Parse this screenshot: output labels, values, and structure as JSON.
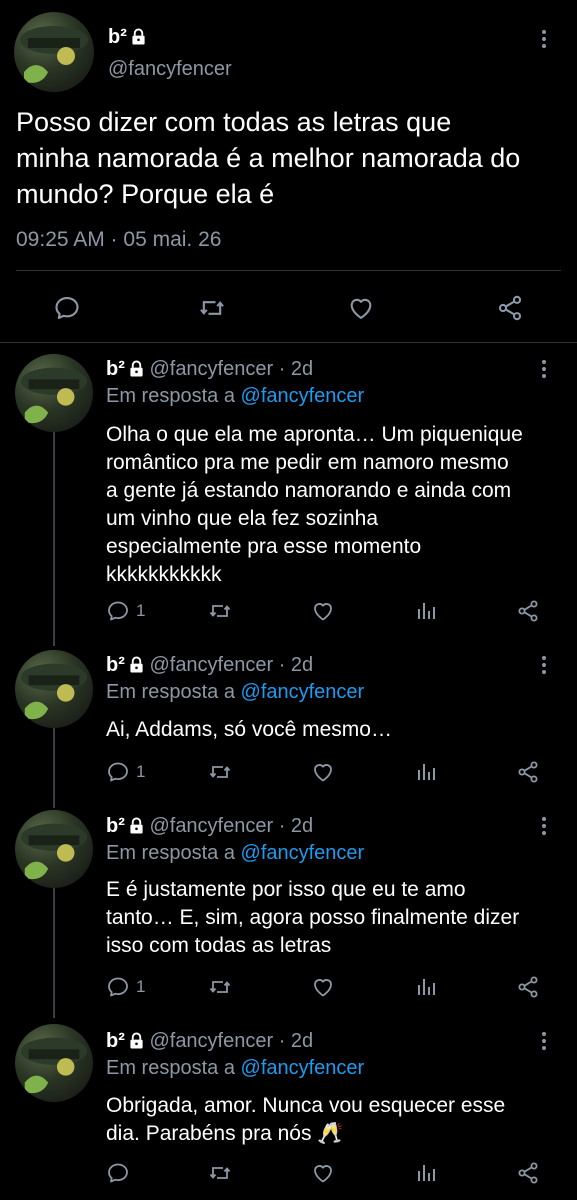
{
  "main_tweet": {
    "display_name": "b²",
    "handle": "@fancyfencer",
    "text_line1": "Posso dizer com todas as letras que",
    "text_line2": "minha namorada é a melhor namorada do",
    "text_line3": "mundo? Porque ela é",
    "timestamp": "09:25 AM · 05 mai. 26"
  },
  "replies": [
    {
      "display_name": "b²",
      "handle_time": "@fancyfencer · 2d",
      "reply_prefix": "Em resposta a",
      "reply_to": "@fancyfencer",
      "lines": [
        "Olha o que ela me apronta… Um piquenique",
        "romântico pra me pedir em namoro mesmo",
        "a gente já estando namorando e ainda com",
        "um vinho que ela fez sozinha",
        "especialmente pra esse momento",
        "kkkkkkkkkkk"
      ],
      "reply_count": "1"
    },
    {
      "display_name": "b²",
      "handle_time": "@fancyfencer · 2d",
      "reply_prefix": "Em resposta a",
      "reply_to": "@fancyfencer",
      "lines": [
        "Ai, Addams, só você mesmo…"
      ],
      "reply_count": "1"
    },
    {
      "display_name": "b²",
      "handle_time": "@fancyfencer · 2d",
      "reply_prefix": "Em resposta a",
      "reply_to": "@fancyfencer",
      "lines": [
        "E é justamente por isso que eu te amo",
        "tanto… E, sim, agora posso finalmente dizer",
        "isso com todas as letras"
      ],
      "reply_count": "1"
    },
    {
      "display_name": "b²",
      "handle_time": "@fancyfencer · 2d",
      "reply_prefix": "Em resposta a",
      "reply_to": "@fancyfencer",
      "lines": [
        "Obrigada, amor. Nunca vou esquecer esse",
        "dia. Parabéns pra nós 🥂"
      ],
      "reply_count": ""
    }
  ],
  "icons": {
    "lock": "lock-icon",
    "reply": "reply-icon",
    "retweet": "retweet-icon",
    "like": "like-icon",
    "share": "share-icon",
    "views": "views-icon",
    "more": "more-icon"
  },
  "colors": {
    "background": "#000000",
    "text": "#e7e9ea",
    "muted": "#8b98a5",
    "link": "#1d9bf0"
  }
}
